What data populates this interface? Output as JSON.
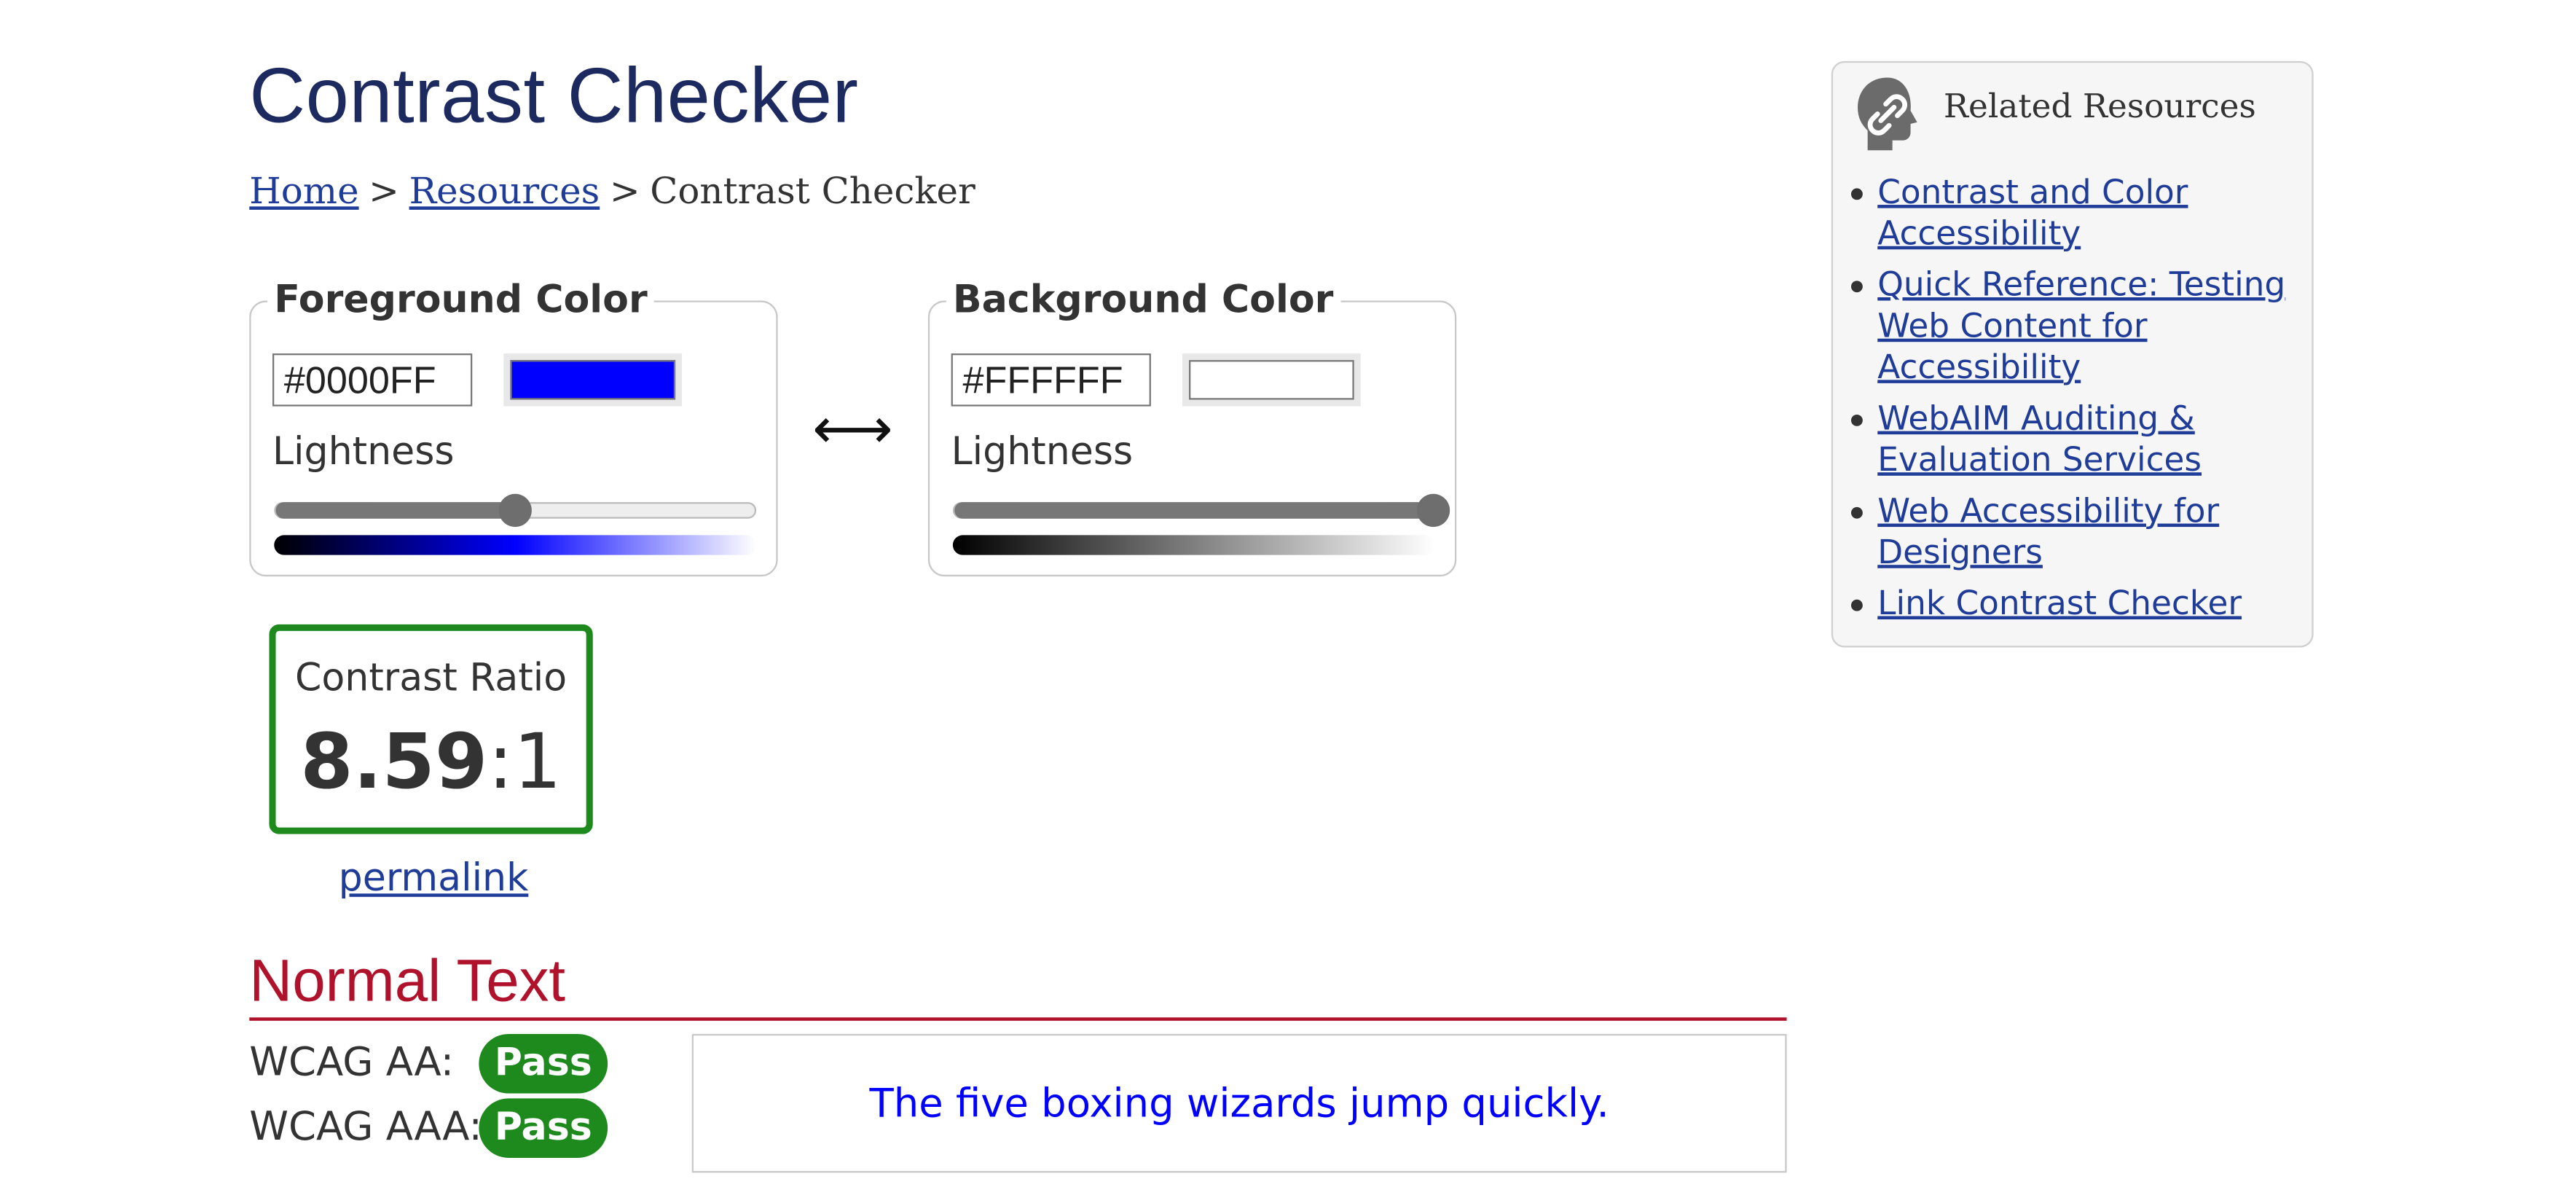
{
  "page": {
    "title": "Contrast Checker",
    "breadcrumb": [
      {
        "label": "Home",
        "link": true
      },
      {
        "label": "Resources",
        "link": true
      },
      {
        "label": "Contrast Checker",
        "link": false
      }
    ],
    "breadcrumb_separator": ">"
  },
  "foreground": {
    "legend": "Foreground Color",
    "hex_value": "#0000FF",
    "swatch_color": "#0000FF",
    "lightness_label": "Lightness",
    "lightness_percent": 50
  },
  "background": {
    "legend": "Background Color",
    "hex_value": "#FFFFFF",
    "swatch_color": "#FFFFFF",
    "lightness_label": "Lightness",
    "lightness_percent": 100
  },
  "swap": {
    "icon": "swap-arrows-icon",
    "glyph": "⟷"
  },
  "contrast": {
    "label": "Contrast Ratio",
    "ratio": "8.59",
    "suffix": ":1",
    "border_color": "#1e8a1e"
  },
  "permalink": "permalink",
  "normal_text": {
    "heading": "Normal Text",
    "heading_color": "#b0122b",
    "rows": [
      {
        "label": "WCAG AA:",
        "result": "Pass"
      },
      {
        "label": "WCAG AAA:",
        "result": "Pass"
      }
    ],
    "pass_color": "#1e8a1e",
    "sample_text": "The five boxing wizards jump quickly."
  },
  "related": {
    "title": "Related Resources",
    "icon": "link-head-icon",
    "items": [
      "Contrast and Color Accessibility",
      "Quick Reference: Testing Web Content for Accessibility",
      "WebAIM Auditing & Evaluation Services",
      "Web Accessibility for Designers",
      "Link Contrast Checker"
    ]
  }
}
